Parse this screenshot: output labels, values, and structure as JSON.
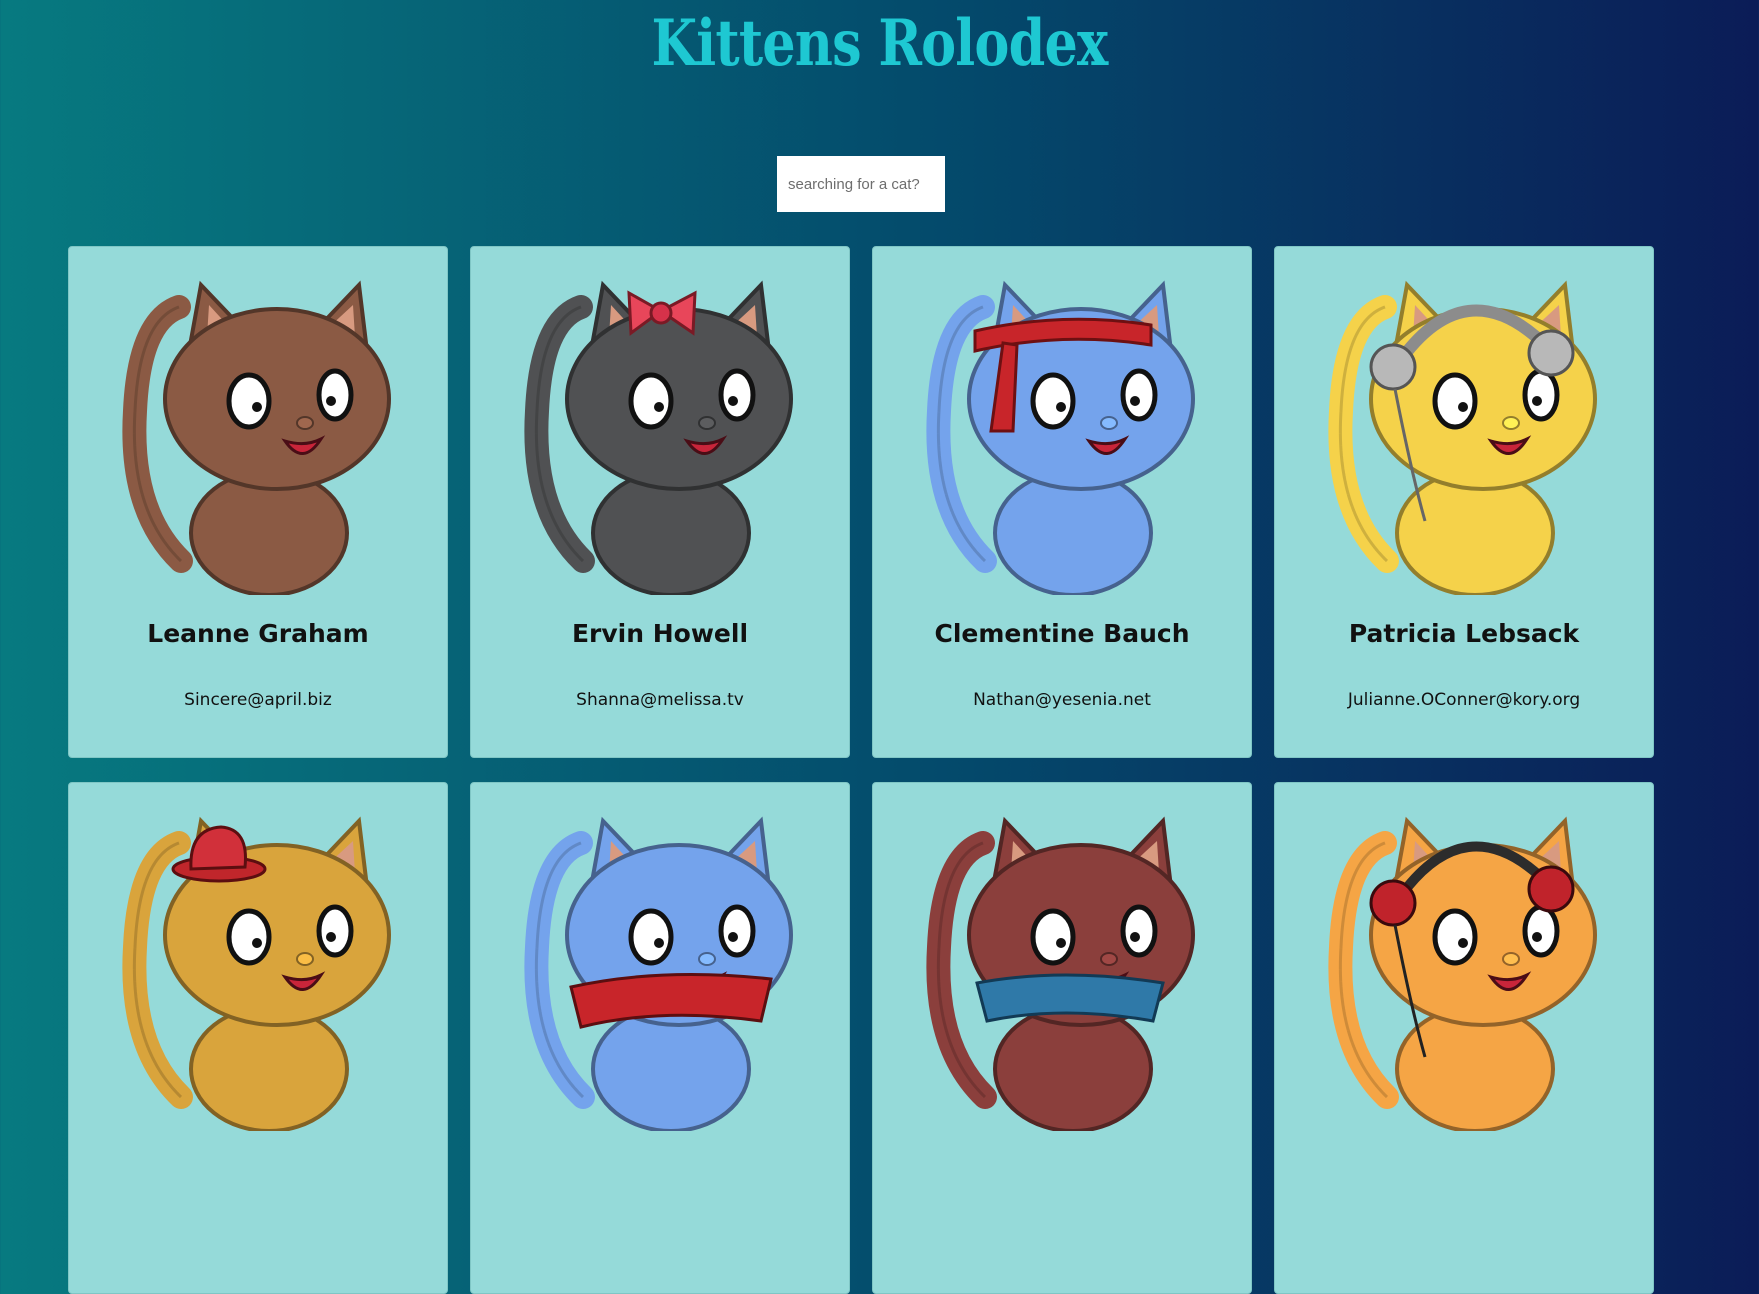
{
  "header": {
    "title": "Kittens Rolodex"
  },
  "search": {
    "placeholder": "searching for a cat?",
    "value": ""
  },
  "cards": [
    {
      "name": "Leanne Graham",
      "email": "Sincere@april.biz",
      "color": "#8b5a44",
      "accessory": "none"
    },
    {
      "name": "Ervin Howell",
      "email": "Shanna@melissa.tv",
      "color": "#505153",
      "accessory": "bow"
    },
    {
      "name": "Clementine Bauch",
      "email": "Nathan@yesenia.net",
      "color": "#74a3ec",
      "accessory": "headband"
    },
    {
      "name": "Patricia Lebsack",
      "email": "Julianne.OConner@kory.org",
      "color": "#f5d24a",
      "accessory": "headphones"
    },
    {
      "name": "",
      "email": "",
      "color": "#d9a43c",
      "accessory": "hat"
    },
    {
      "name": "",
      "email": "",
      "color": "#74a3ec",
      "accessory": "scarf"
    },
    {
      "name": "",
      "email": "",
      "color": "#8b3f3c",
      "accessory": "bandana"
    },
    {
      "name": "",
      "email": "",
      "color": "#f5a545",
      "accessory": "headphones-red"
    }
  ]
}
